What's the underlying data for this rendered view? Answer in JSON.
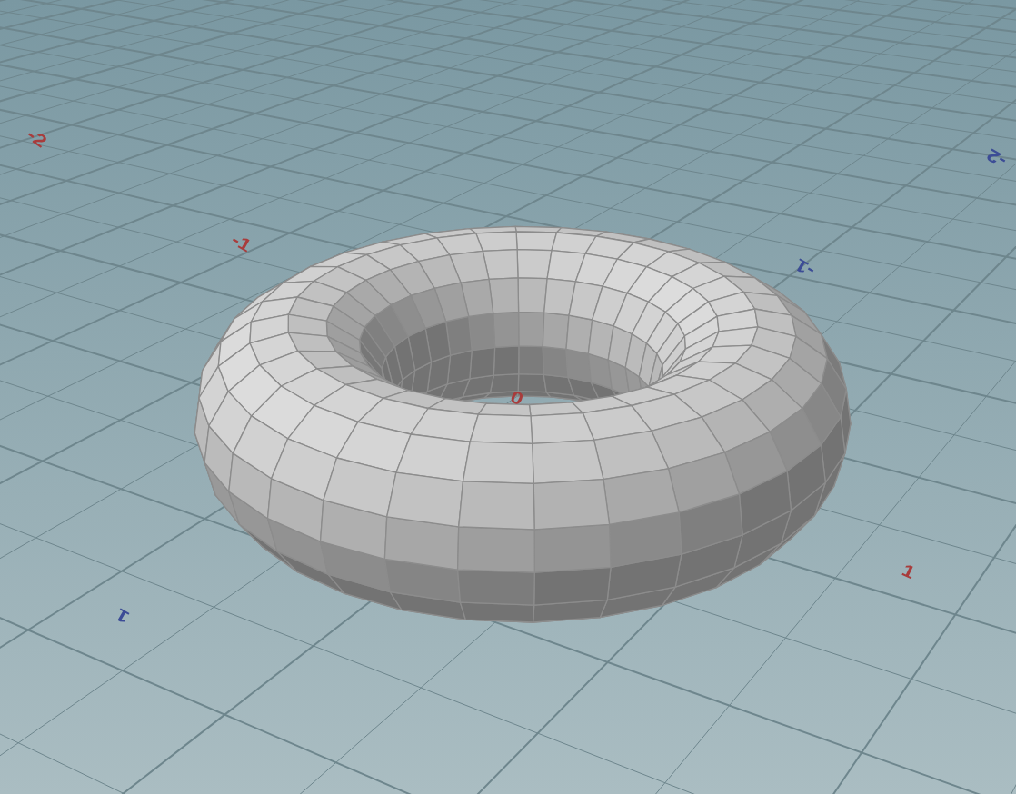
{
  "viewport": {
    "axis_labels": [
      {
        "text": "-2",
        "color": "#a83c3c"
      },
      {
        "text": "-1",
        "color": "#a83c3c"
      },
      {
        "text": "0",
        "color": "#a83c3c"
      },
      {
        "text": "1",
        "color": "#a83c3c"
      },
      {
        "text": "1",
        "color": "#3c4c96"
      },
      {
        "text": "-1",
        "color": "#3c4c96"
      },
      {
        "text": "-2",
        "color": "#3c4c96"
      }
    ]
  }
}
